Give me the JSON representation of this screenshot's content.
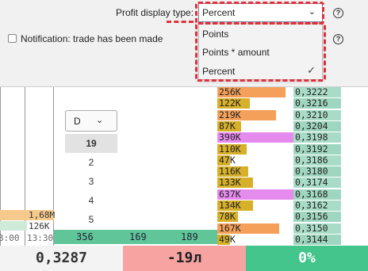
{
  "settings": {
    "profit_label": "Profit display type:",
    "notification_label": "Notification: trade has been made",
    "help_glyph": "?",
    "select": {
      "value": "Percent",
      "chevron": "⌄"
    },
    "options": [
      {
        "label": "Points",
        "selected": false
      },
      {
        "label": "Points * amount",
        "selected": false
      },
      {
        "label": "Percent",
        "selected": true
      }
    ],
    "check_glyph": "✓"
  },
  "chart": {
    "time_labels": [
      "3:00",
      "13:30"
    ],
    "left_volumes": [
      "1,68M",
      "126K"
    ],
    "trade_counts": [
      "356",
      "169",
      "189"
    ],
    "volume_filter": {
      "button_label": "D",
      "chevron": "⌄",
      "options": [
        "19",
        "2",
        "3",
        "4",
        "5"
      ],
      "selected": "19"
    }
  },
  "order_book": [
    {
      "volume": "256K",
      "price": "0,3222",
      "fill": 0.9,
      "color": "#f4a05a"
    },
    {
      "volume": "122K",
      "price": "0,3216",
      "fill": 0.43,
      "color": "#d7b02a"
    },
    {
      "volume": "219K",
      "price": "0,3210",
      "fill": 0.77,
      "color": "#f4a05a"
    },
    {
      "volume": "87K",
      "price": "0,3204",
      "fill": 0.31,
      "color": "#d7b02a"
    },
    {
      "volume": "390K",
      "price": "0,3198",
      "fill": 1.0,
      "color": "#e68bee"
    },
    {
      "volume": "110K",
      "price": "0,3192",
      "fill": 0.39,
      "color": "#d7b02a"
    },
    {
      "volume": "47K",
      "price": "0,3186",
      "fill": 0.17,
      "color": "#d7b02a"
    },
    {
      "volume": "116K",
      "price": "0,3180",
      "fill": 0.41,
      "color": "#d7b02a"
    },
    {
      "volume": "133K",
      "price": "0,3174",
      "fill": 0.47,
      "color": "#d7b02a"
    },
    {
      "volume": "637K",
      "price": "0,3168",
      "fill": 1.0,
      "color": "#e68bee"
    },
    {
      "volume": "134K",
      "price": "0,3162",
      "fill": 0.47,
      "color": "#d7b02a"
    },
    {
      "volume": "78K",
      "price": "0,3156",
      "fill": 0.27,
      "color": "#d7b02a"
    },
    {
      "volume": "167K",
      "price": "0,3150",
      "fill": 0.81,
      "color": "#f4a05a"
    },
    {
      "volume": "49K",
      "price": "0,3144",
      "fill": 0.17,
      "color": "#d7b02a"
    }
  ],
  "bottom_bar": {
    "price": "0,3287",
    "pnl": "-19л",
    "percent": "0%",
    "colors": {
      "price_bg": "#f3f3f3",
      "pnl_bg": "#f6a3a1",
      "percent_bg": "#43c58b"
    }
  }
}
